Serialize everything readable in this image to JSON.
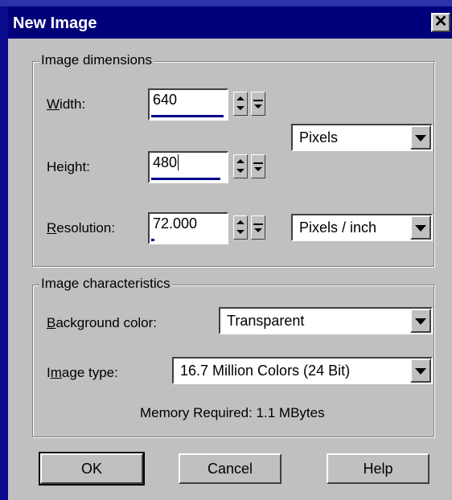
{
  "window": {
    "title": "New Image",
    "close_label": "✕"
  },
  "dimensions": {
    "legend": "Image dimensions",
    "width_label": "Width:",
    "width_value": "640",
    "height_label": "Height:",
    "height_value": "480",
    "resolution_label": "Resolution:",
    "resolution_value": "72.000",
    "units_value": "Pixels",
    "resolution_units_value": "Pixels / inch"
  },
  "characteristics": {
    "legend": "Image characteristics",
    "background_label": "Background color:",
    "background_value": "Transparent",
    "type_label": "Image type:",
    "type_value": "16.7 Million Colors (24 Bit)",
    "memory_text": "Memory Required: 1.1 MBytes"
  },
  "buttons": {
    "ok": "OK",
    "cancel": "Cancel",
    "help": "Help"
  },
  "colors": {
    "titlebar": "#00007b",
    "dialog": "#c0c0c0",
    "background": "#0a0a8c"
  }
}
